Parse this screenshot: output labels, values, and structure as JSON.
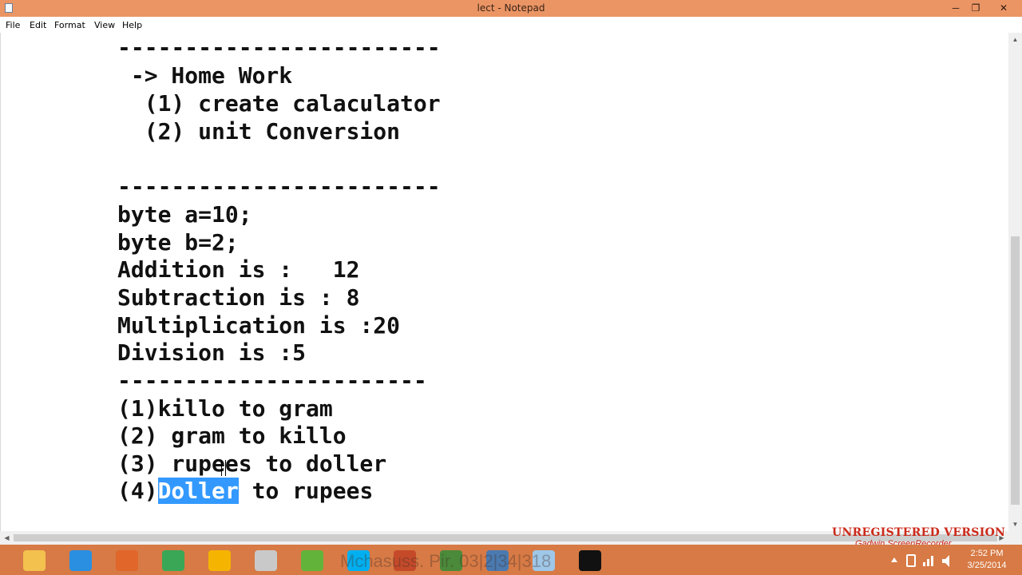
{
  "window": {
    "title": "lect - Notepad",
    "minimize_glyph": "─",
    "maximize_glyph": "❐",
    "close_glyph": "✕"
  },
  "menu": [
    "File",
    "Edit",
    "Format",
    "View",
    "Help"
  ],
  "editor": {
    "lines": [
      "------------------------",
      " -> Home Work",
      "  (1) create calaculator",
      "  (2) unit Conversion",
      "",
      "------------------------",
      "byte a=10;",
      "byte b=2;",
      "Addition is :   12",
      "Subtraction is : 8",
      "Multiplication is :20",
      "Division is :5",
      "-----------------------",
      "(1)killo to gram",
      "(2) gram to killo",
      "(3) rupees to doller"
    ],
    "last_line": {
      "before": "(4)",
      "selected": "Doller",
      "after": " to rupees"
    }
  },
  "watermark": {
    "main": "UNREGISTERED VERSION",
    "sub": "Gadwin ScreenRecorder"
  },
  "taskbar": {
    "items": [
      {
        "name": "file-explorer-icon",
        "color": "#f2c14e"
      },
      {
        "name": "internet-explorer-icon",
        "color": "#2a8fe0"
      },
      {
        "name": "firefox-icon",
        "color": "#e0662a"
      },
      {
        "name": "chrome-icon",
        "color": "#3aa757"
      },
      {
        "name": "app-yellow-icon",
        "color": "#f5b400"
      },
      {
        "name": "app-cvb-icon",
        "color": "#c9c9c9"
      },
      {
        "name": "utorrent-icon",
        "color": "#62b33a"
      },
      {
        "name": "skype-icon",
        "color": "#00aff0"
      },
      {
        "name": "app-red-icon",
        "color": "#c44a2a"
      },
      {
        "name": "app-green-icon",
        "color": "#4a8a3a"
      },
      {
        "name": "app-blue-icon",
        "color": "#4a7ab0"
      },
      {
        "name": "notepad-icon",
        "color": "#9fc7e8"
      },
      {
        "name": "cmd-icon",
        "color": "#111111"
      }
    ],
    "ghost_text": "Mchasuss. Pir. 03|2|34|318",
    "clock_time": "2:52 PM",
    "clock_date": "3/25/2014"
  }
}
